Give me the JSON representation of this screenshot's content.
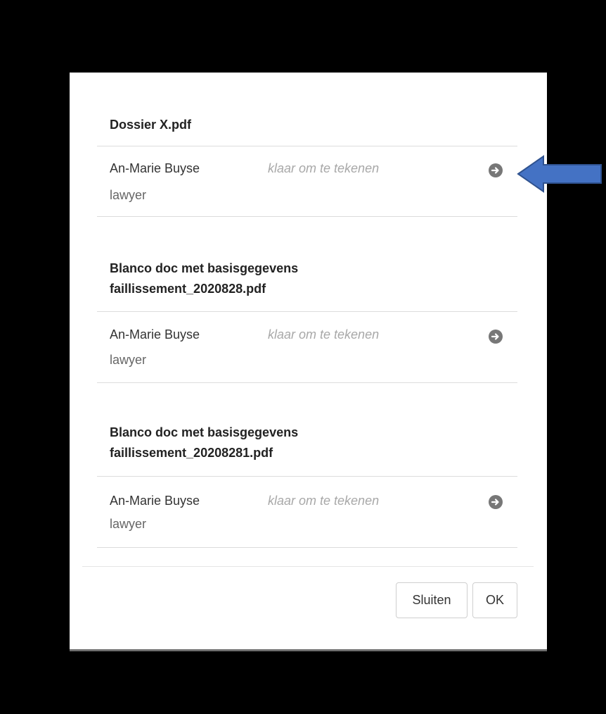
{
  "dialog": {
    "documents": [
      {
        "title_lines": [
          "Dossier X.pdf"
        ],
        "signer": {
          "name": "An-Marie Buyse",
          "role": "lawyer",
          "status": "klaar om te tekenen"
        }
      },
      {
        "title_lines": [
          "Blanco doc met basisgegevens",
          "faillissement_2020828.pdf"
        ],
        "signer": {
          "name": "An-Marie Buyse",
          "role": "lawyer",
          "status": "klaar om te tekenen"
        }
      },
      {
        "title_lines": [
          "Blanco doc met basisgegevens",
          "faillissement_20208281.pdf"
        ],
        "signer": {
          "name": "An-Marie Buyse",
          "role": "lawyer",
          "status": "klaar om te tekenen"
        }
      }
    ],
    "footer": {
      "close_label": "Sluiten",
      "ok_label": "OK"
    }
  },
  "icons": {
    "sign_arrow": "arrow-circle-right-icon",
    "pointer": "blue-arrow-pointer-icon"
  },
  "colors": {
    "overlay": "#000000",
    "arrow_pointer": "#4472c4",
    "sign_icon": "#777777"
  }
}
